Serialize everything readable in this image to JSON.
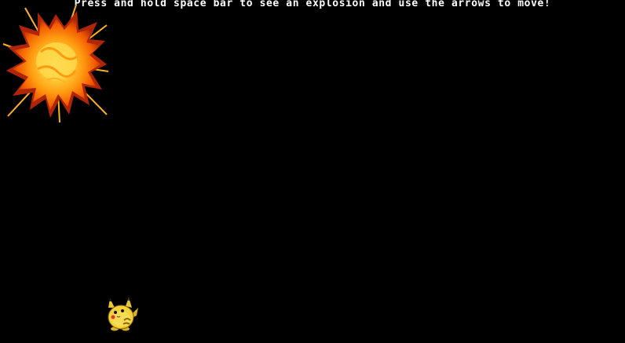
{
  "game": {
    "instruction": "Press and hold space bar to see an explosion and use the arrows to move!"
  },
  "sprites": {
    "explosion_icon": "explosion-sprite",
    "player_icon": "pikachu-sprite"
  },
  "colors": {
    "background": "#000000",
    "text": "#ffffff",
    "explosion_core": "#ffd23a",
    "explosion_mid": "#ff8a00",
    "explosion_edge": "#c0300a",
    "player_body": "#f2d23a"
  }
}
